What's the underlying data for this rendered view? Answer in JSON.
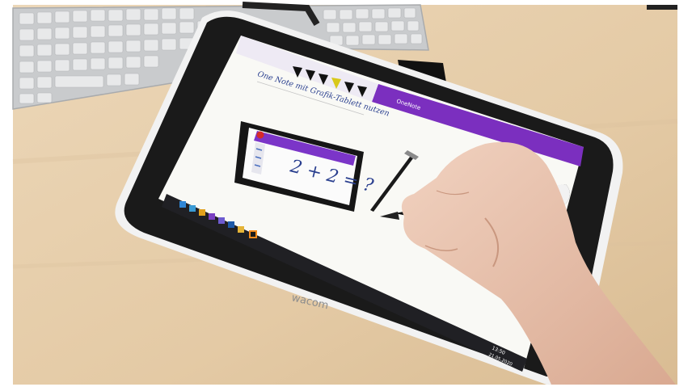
{
  "photo": {
    "note_title": "One Note mit Grafik-Tablett nutzen",
    "equation": "2 + 2 = ?",
    "tablet_brand": "wacom",
    "app_title": "OneNote",
    "taskbar_time": "13:50",
    "taskbar_date": "21.05.2020",
    "colors": {
      "desk": "#e6cfae",
      "tablet_bezel": "#1a1a1a",
      "tablet_shell": "#f2f2f2",
      "onenote_purple": "#7b2fbf",
      "keyboard": "#c9cbcd"
    }
  }
}
